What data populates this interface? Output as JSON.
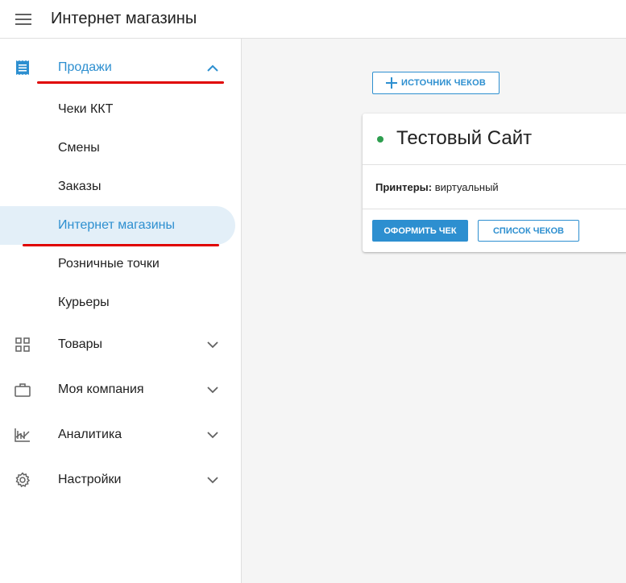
{
  "header": {
    "title": "Интернет магазины",
    "menu_icon": "hamburger-menu-icon"
  },
  "sidebar": {
    "sections": [
      {
        "label": "Продажи",
        "icon": "receipt-icon",
        "expanded": true,
        "items": [
          "Чеки ККТ",
          "Смены",
          "Заказы",
          "Интернет магазины",
          "Розничные точки",
          "Курьеры"
        ],
        "selected_item": "Интернет магазины"
      },
      {
        "label": "Товары",
        "icon": "grid-icon",
        "expanded": false
      },
      {
        "label": "Моя компания",
        "icon": "briefcase-icon",
        "expanded": false
      },
      {
        "label": "Аналитика",
        "icon": "analytics-icon",
        "expanded": false
      },
      {
        "label": "Настройки",
        "icon": "gear-icon",
        "expanded": false
      }
    ]
  },
  "main": {
    "add_source_button": "ИСТОЧНИК ЧЕКОВ",
    "card": {
      "title": "Тестовый Сайт",
      "status": "active",
      "printers_label": "Принтеры:",
      "printers_value": "виртуальный",
      "primary_button": "ОФОРМИТЬ ЧЕК",
      "secondary_button": "СПИСОК ЧЕКОВ"
    }
  },
  "colors": {
    "accent": "#2d8fd0",
    "status_green": "#2e9e4f",
    "selected_bg": "#e3eff8",
    "annotation_red": "#e00000"
  }
}
